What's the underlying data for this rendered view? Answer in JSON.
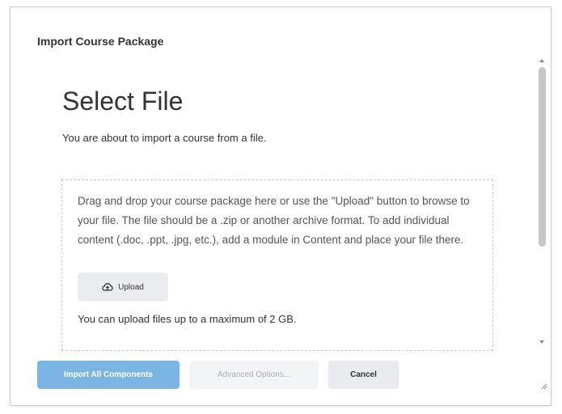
{
  "dialog": {
    "title": "Import Course Package"
  },
  "content": {
    "heading": "Select File",
    "intro": "You are about to import a course from a file.",
    "dropzone_text": "Drag and drop your course package here or use the \"Upload\" button to browse to your file. The file should be a .zip or another archive format. To add individual content (.doc, .ppt, .jpg, etc.), add a module in Content and place your file there.",
    "upload_label": "Upload",
    "upload_icon": "cloud-upload-icon",
    "limit_text": "You can upload files up to a maximum of 2 GB."
  },
  "footer": {
    "import_label": "Import All Components",
    "advanced_label": "Advanced Options...",
    "cancel_label": "Cancel"
  },
  "colors": {
    "primary": "#7bb5e3",
    "neutral_button": "#e9ebee",
    "disabled_text": "#a9adb3"
  }
}
